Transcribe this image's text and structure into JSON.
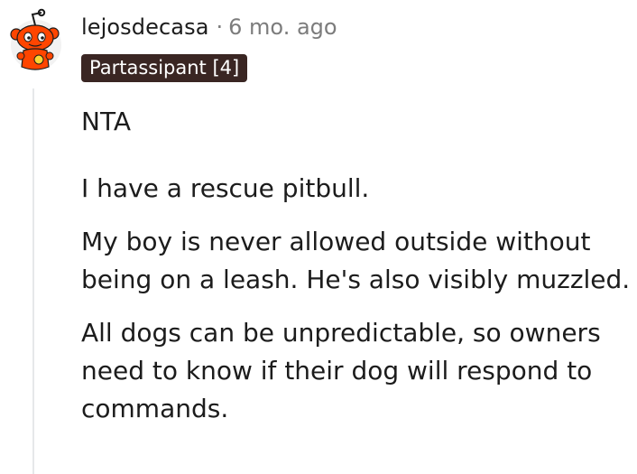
{
  "comment": {
    "username": "lejosdecasa",
    "separator": "·",
    "timestamp": "6 mo. ago",
    "flair": "Partassipant [4]",
    "avatar_icon": "snoo-avatar-icon",
    "paragraphs": [
      "NTA",
      "I have a rescue pitbull.",
      "My boy is never allowed outside without being on a leash. He's also visibly muzzled.",
      "All dogs can be unpredictable, so owners need to know if their dog will respond to commands."
    ]
  },
  "colors": {
    "flair_bg": "#3a2623",
    "meta_text": "#7c7c7c",
    "thread_line": "#e6e8ea"
  }
}
